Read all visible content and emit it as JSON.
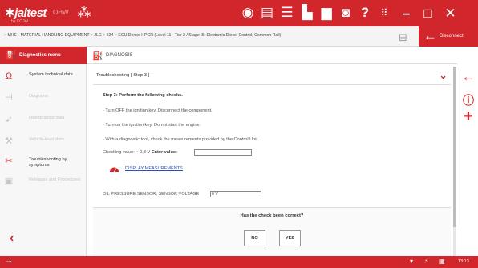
{
  "header": {
    "logo": "jaltest",
    "logo_sub": "by COJALI",
    "logo_tag": "OHW",
    "icons": [
      "group-icon",
      "globe-icon",
      "document-icon",
      "list-icon",
      "print-icon",
      "bus-icon",
      "camera-icon",
      "help-icon",
      "grid-icon"
    ],
    "help_glyph": "?",
    "minimize": "–",
    "maximize": "□",
    "close": "✕"
  },
  "breadcrumb": {
    "items": [
      "MHE - MATERIAL HANDLING EQUIPMENT",
      "JLG",
      "534",
      "ECU Denso HPCR (Level 11 - Tier 2 / Stage III, Electronic Diesel Control, Common Rail)"
    ],
    "separator": ">",
    "disconnect_label": "Disconnect"
  },
  "sidebar": {
    "title": "Diagnostics menu",
    "items": [
      {
        "label": "System technical data",
        "icon": "magnet-icon",
        "state": "normal"
      },
      {
        "label": "Diagrams",
        "icon": "diagram-icon",
        "state": "dim"
      },
      {
        "label": "Maintenance data",
        "icon": "maintenance-icon",
        "state": "dim"
      },
      {
        "label": "Vehicle-level data",
        "icon": "wrench-icon",
        "state": "dim"
      },
      {
        "label": "Troubleshooting by symptoms",
        "icon": "troubleshoot-icon",
        "state": "active"
      },
      {
        "label": "Releases and Procedures",
        "icon": "procedures-icon",
        "state": "dim"
      }
    ],
    "back_glyph": "‹"
  },
  "main": {
    "title": "DIAGNOSIS",
    "subheader": "Troubleshooting [ Step 3 ]",
    "step_title": "Step 3: Perform the following checks.",
    "instructions": [
      "- Turn OFF the ignition key. Disconnect the component.",
      "- Turn on the ignition key. Do not start the engine.",
      "- With a diagnostic tool, check the measurements provided by the Control Unit."
    ],
    "checking_value_label": "Checking value:",
    "checking_value": "~ 0,3 V",
    "enter_value_label": "Enter value:",
    "enter_value": "",
    "display_measurements_label": "DISPLAY MEASUREMENTS",
    "sensor_label": "OIL PRESSURE SENSOR, SENSOR VOLTAGE",
    "sensor_value": "0 V",
    "question": "Has the check been correct?",
    "no_label": "NO",
    "yes_label": "YES"
  },
  "right_rail": {
    "back_glyph": "←",
    "info_glyph": "ⓘ",
    "add_glyph": "+"
  },
  "bottom_bar": {
    "usb_glyph": "⇝",
    "wifi_glyph": "▾",
    "battery_glyph": "⚡",
    "calendar_glyph": "▦",
    "time": "13:13"
  },
  "colors": {
    "brand_red": "#d1262b",
    "link_blue": "#2b4fb0"
  }
}
